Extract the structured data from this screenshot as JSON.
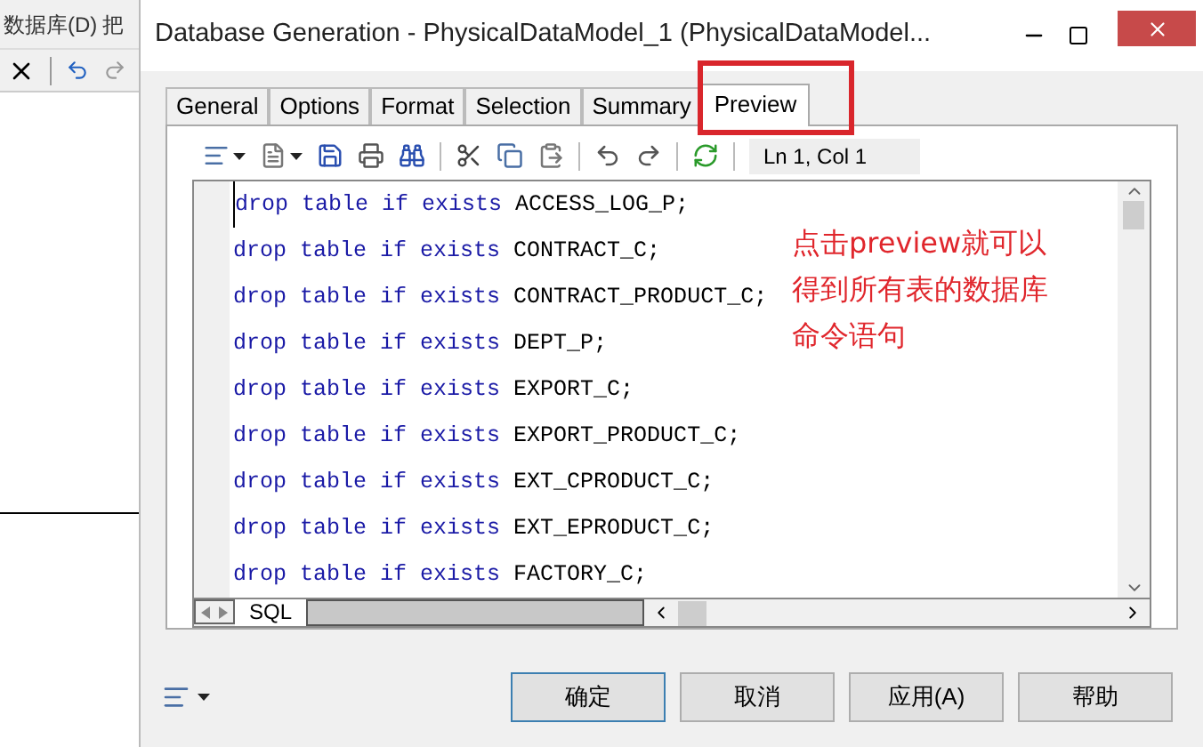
{
  "background_app": {
    "menu": [
      "数据库(D)",
      "把"
    ]
  },
  "dialog": {
    "title": "Database Generation - PhysicalDataModel_1 (PhysicalDataModel...",
    "tabs": [
      {
        "label": "General",
        "selected": false,
        "highlighted": false
      },
      {
        "label": "Options",
        "selected": false,
        "highlighted": false
      },
      {
        "label": "Format",
        "selected": false,
        "highlighted": false
      },
      {
        "label": "Selection",
        "selected": false,
        "highlighted": false
      },
      {
        "label": "Summary",
        "selected": false,
        "highlighted": false
      },
      {
        "label": "Preview",
        "selected": true,
        "highlighted": true
      }
    ],
    "editor": {
      "position": "Ln 1, Col 1",
      "sheet_tab": "SQL",
      "lines": [
        {
          "keyword": "drop table if exists",
          "name": "ACCESS_LOG_P;"
        },
        {
          "keyword": "drop table if exists",
          "name": "CONTRACT_C;"
        },
        {
          "keyword": "drop table if exists",
          "name": "CONTRACT_PRODUCT_C;"
        },
        {
          "keyword": "drop table if exists",
          "name": "DEPT_P;"
        },
        {
          "keyword": "drop table if exists",
          "name": "EXPORT_C;"
        },
        {
          "keyword": "drop table if exists",
          "name": "EXPORT_PRODUCT_C;"
        },
        {
          "keyword": "drop table if exists",
          "name": "EXT_CPRODUCT_C;"
        },
        {
          "keyword": "drop table if exists",
          "name": "EXT_EPRODUCT_C;"
        },
        {
          "keyword": "drop table if exists",
          "name": "FACTORY_C;"
        }
      ]
    },
    "annotation": [
      "点击preview就可以",
      "得到所有表的数据库",
      "命令语句"
    ],
    "buttons": [
      {
        "label": "确定",
        "default": true
      },
      {
        "label": "取消",
        "default": false
      },
      {
        "label": "应用(A)",
        "default": false
      },
      {
        "label": "帮助",
        "default": false
      }
    ]
  }
}
